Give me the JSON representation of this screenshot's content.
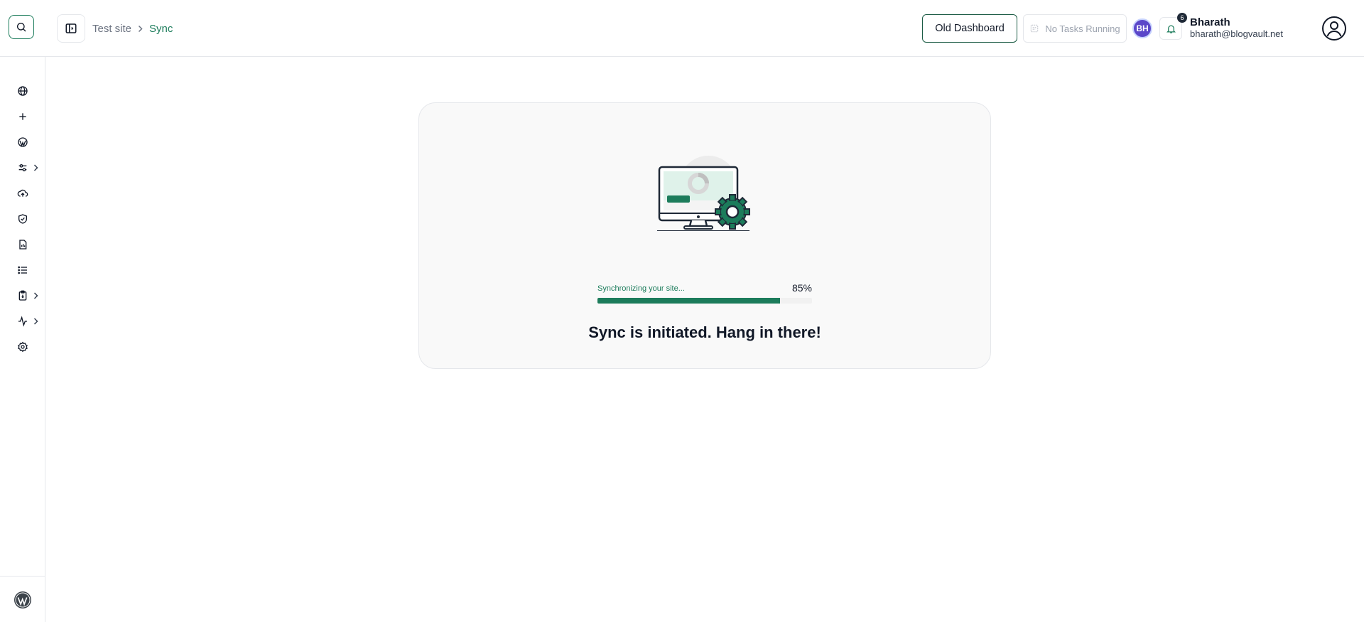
{
  "rail": {
    "items": [
      {
        "name": "globe-icon"
      },
      {
        "name": "plus-icon"
      },
      {
        "name": "wordpress-icon"
      },
      {
        "name": "sliders-icon",
        "has_children": true
      },
      {
        "name": "cloud-upload-icon"
      },
      {
        "name": "shield-check-icon"
      },
      {
        "name": "file-chart-icon"
      },
      {
        "name": "list-icon"
      },
      {
        "name": "clipboard-icon",
        "has_children": true
      },
      {
        "name": "activity-icon",
        "has_children": true
      },
      {
        "name": "gear-icon"
      }
    ],
    "footer_icon": "wordpress-logo-icon"
  },
  "header": {
    "breadcrumb": {
      "root": "Test site",
      "current": "Sync"
    },
    "old_dashboard_label": "Old Dashboard",
    "tasks_label": "No Tasks Running",
    "avatar_initials": "BH",
    "notification_count": "6",
    "user": {
      "name": "Bharath",
      "email": "bharath@blogvault.net"
    }
  },
  "sync": {
    "progress_label": "Synchronizing your site...",
    "progress_percent_text": "85%",
    "progress_value": 0.85,
    "title": "Sync is initiated. Hang in there!"
  },
  "colors": {
    "brand": "#1c7c5b",
    "avatar": "#5b47c9"
  }
}
